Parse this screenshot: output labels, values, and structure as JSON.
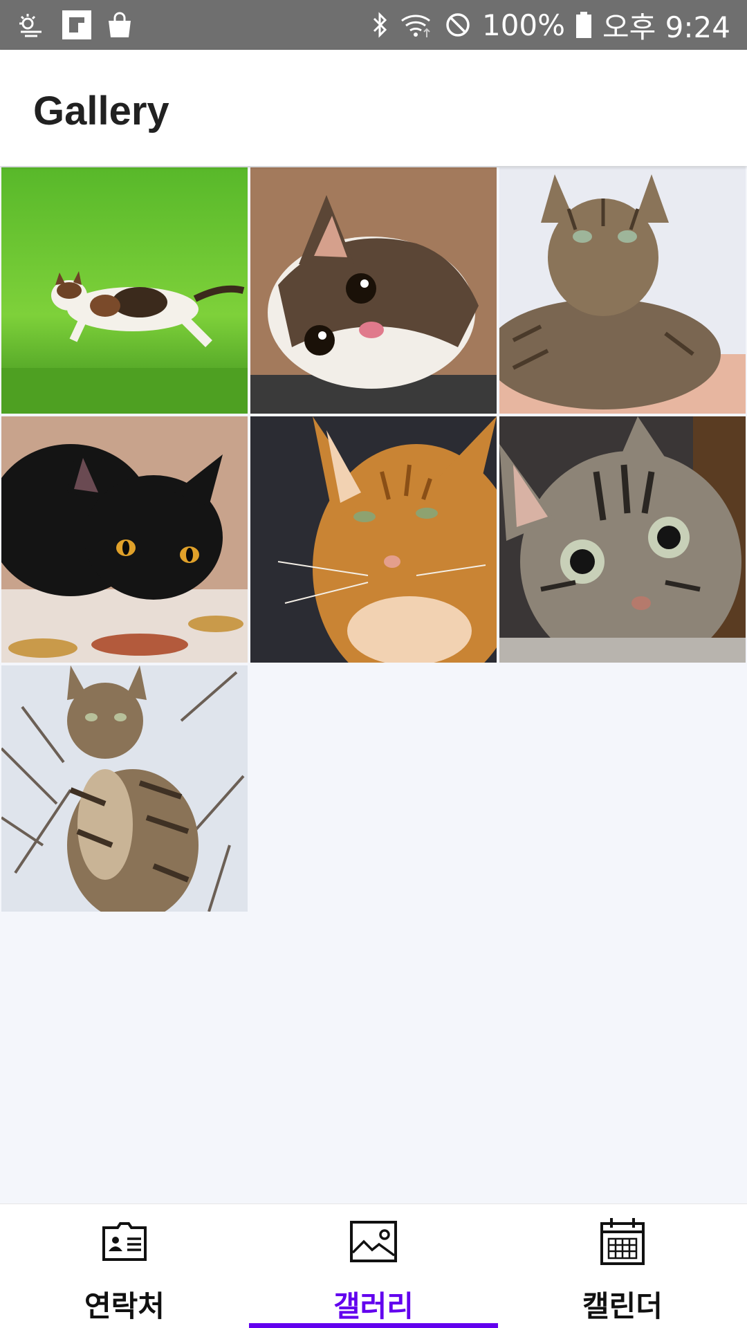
{
  "status_bar": {
    "battery": "100%",
    "time": "오후 9:24"
  },
  "app_bar": {
    "title": "Gallery"
  },
  "gallery": {
    "images": [
      {
        "name": "cat-photo-jumping-kitten"
      },
      {
        "name": "cat-photo-tilted-head"
      },
      {
        "name": "cat-photo-tabby-lying"
      },
      {
        "name": "cat-photo-black-cat"
      },
      {
        "name": "cat-photo-orange-cat"
      },
      {
        "name": "cat-photo-tabby-kitten"
      },
      {
        "name": "cat-photo-tabby-sitting"
      }
    ]
  },
  "bottom_nav": {
    "items": [
      {
        "label": "연락처",
        "icon": "contact-card-icon",
        "active": false
      },
      {
        "label": "갤러리",
        "icon": "image-icon",
        "active": true
      },
      {
        "label": "캘린더",
        "icon": "calendar-icon",
        "active": false
      }
    ],
    "accent_color": "#6200ee"
  }
}
